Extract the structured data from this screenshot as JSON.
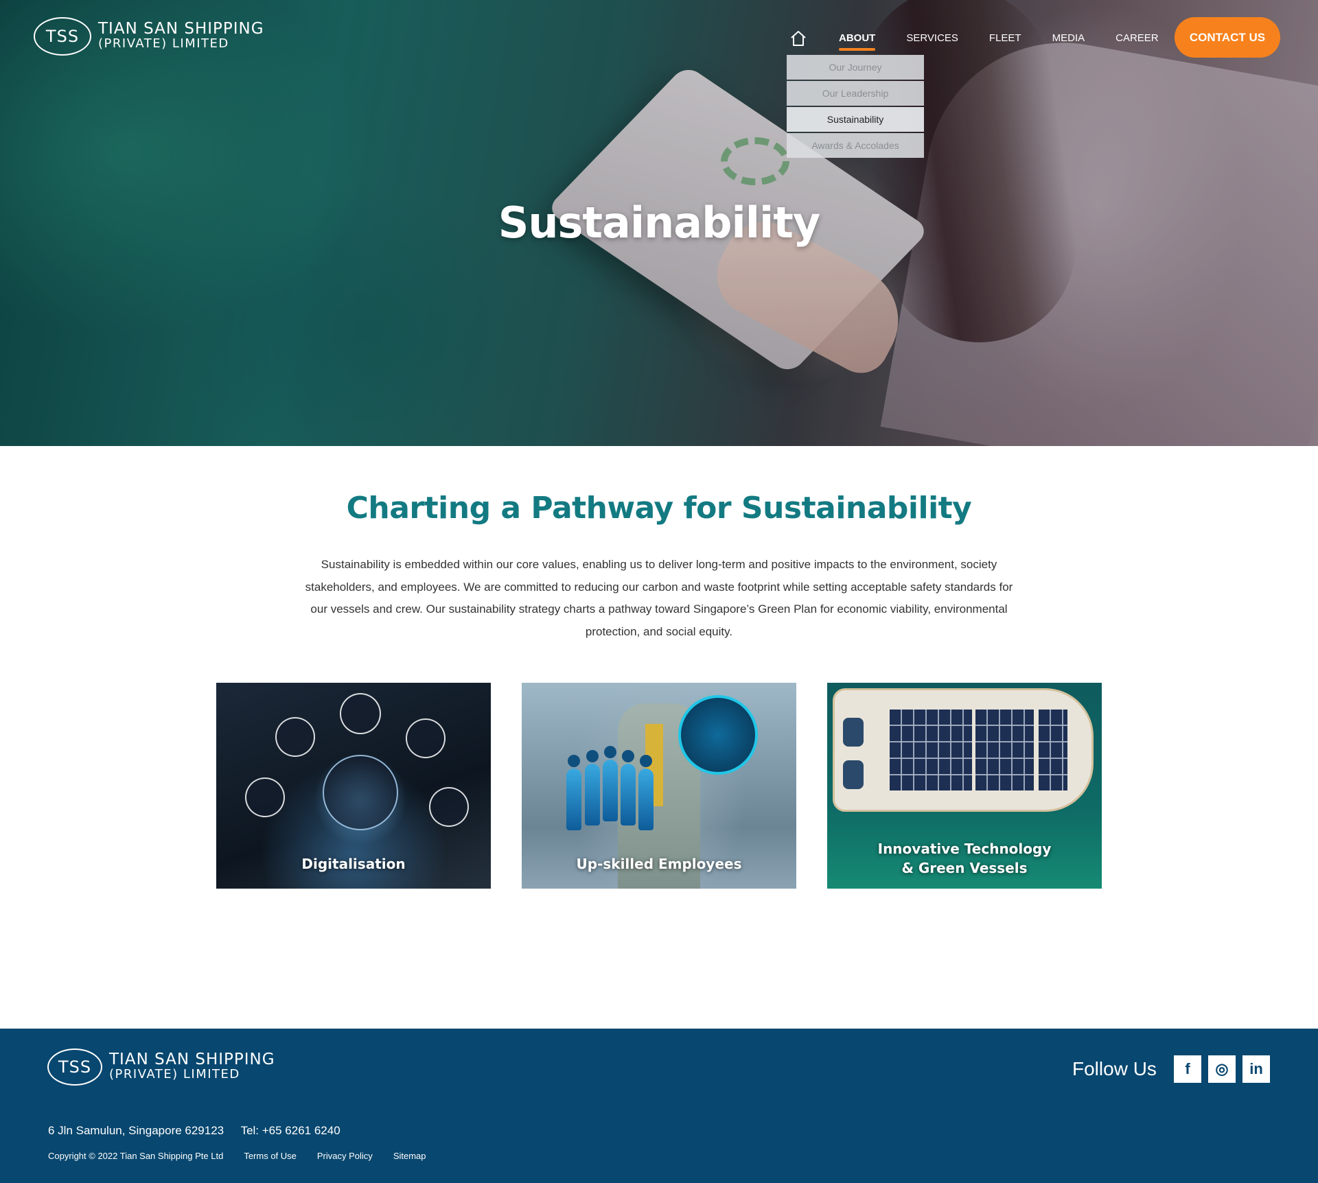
{
  "brand": {
    "logo_mark": "TSS",
    "name_line1": "TIAN SAN SHIPPING",
    "name_line2": "(PRIVATE) LIMITED"
  },
  "nav": {
    "home_icon": "home-icon",
    "items": [
      {
        "label": "ABOUT",
        "active": true
      },
      {
        "label": "SERVICES"
      },
      {
        "label": "FLEET"
      },
      {
        "label": "MEDIA"
      },
      {
        "label": "CAREER"
      }
    ],
    "contact_label": "CONTACT US",
    "accent_color": "#f7821d"
  },
  "about_dropdown": {
    "items": [
      {
        "label": "Our Journey"
      },
      {
        "label": "Our Leadership"
      },
      {
        "label": "Sustainability",
        "selected": true
      },
      {
        "label": "Awards & Accolades"
      }
    ]
  },
  "hero": {
    "title": "Sustainability"
  },
  "intro": {
    "heading": "Charting a Pathway for Sustainability",
    "body": "Sustainability is embedded within our core values, enabling us to deliver long-term and positive impacts to the environment, society stakeholders, and employees. We are committed to reducing our carbon and waste footprint while setting acceptable safety standards for our vessels and crew. Our sustainability strategy charts a pathway toward Singapore’s Green Plan for economic viability, environmental protection, and social equity.",
    "heading_color": "#137a82"
  },
  "cards": [
    {
      "label": "Digitalisation"
    },
    {
      "label": "Up-skilled Employees"
    },
    {
      "label_line1": "Innovative Technology",
      "label_line2": "& Green Vessels"
    }
  ],
  "footer": {
    "follow_label": "Follow Us",
    "social": [
      {
        "icon": "facebook-icon",
        "glyph": "f"
      },
      {
        "icon": "instagram-icon",
        "glyph": "◎"
      },
      {
        "icon": "linkedin-icon",
        "glyph": "in"
      }
    ],
    "address": "6 Jln Samulun, Singapore 629123",
    "tel": "Tel: +65 6261 6240",
    "copyright": "Copyright © 2022 Tian San Shipping Pte Ltd",
    "links": [
      "Terms of Use",
      "Privacy Policy",
      "Sitemap"
    ],
    "bg_color": "#08476f"
  }
}
